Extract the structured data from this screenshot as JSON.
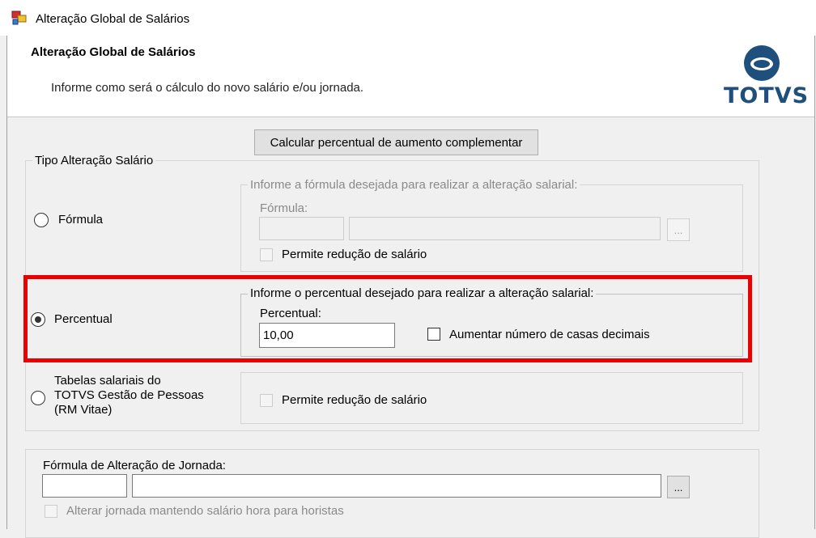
{
  "window": {
    "title": "Alteração Global de Salários"
  },
  "header": {
    "title": "Alteração Global de Salários",
    "subtitle": "Informe como será o cálculo do novo salário e/ou jornada.",
    "logo_text": "TOTVS"
  },
  "colors": {
    "highlight": "#ea0000",
    "logo": "#1f4f7c"
  },
  "calc_button_label": "Calcular percentual de aumento complementar",
  "tipo_alteracao": {
    "legend": "Tipo Alteração Salário",
    "formula_option": {
      "label": "Fórmula",
      "selected": false,
      "group_legend": "Informe a fórmula desejada para realizar a alteração salarial:",
      "field_label": "Fórmula:",
      "code_value": "",
      "description_value": "",
      "browse_label": "...",
      "checkbox_label": "Permite redução de salário",
      "checkbox_checked": false,
      "enabled": false
    },
    "percentual_option": {
      "label": "Percentual",
      "selected": true,
      "group_legend": "Informe o percentual desejado para realizar a alteração salarial:",
      "field_label": "Percentual:",
      "value": "10,00",
      "checkbox_label": "Aumentar número de casas decimais",
      "checkbox_checked": false
    },
    "tabelas_option": {
      "label_line1": "Tabelas salariais do",
      "label_line2": "TOTVS Gestão de Pessoas",
      "label_line3": "(RM Vitae)",
      "selected": false,
      "checkbox_label": "Permite redução de salário",
      "checkbox_checked": false,
      "enabled": false
    }
  },
  "jornada": {
    "field_label": "Fórmula de Alteração de Jornada:",
    "code_value": "",
    "description_value": "",
    "browse_label": "...",
    "checkbox_label": "Alterar jornada mantendo salário hora para horistas",
    "checkbox_checked": false
  }
}
